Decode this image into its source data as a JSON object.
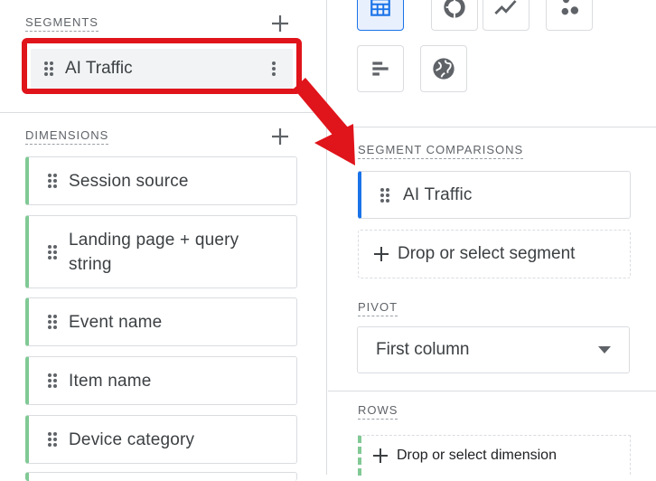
{
  "segments": {
    "title": "SEGMENTS",
    "items": [
      {
        "label": "AI Traffic"
      }
    ]
  },
  "dimensions": {
    "title": "DIMENSIONS",
    "items": [
      {
        "label": "Session source"
      },
      {
        "label": "Landing page + query string"
      },
      {
        "label": "Event name"
      },
      {
        "label": "Item name"
      },
      {
        "label": "Device category"
      }
    ]
  },
  "visualization": {
    "options": [
      {
        "icon": "table-icon",
        "selected": true
      },
      {
        "icon": "donut-chart-icon",
        "selected": false
      },
      {
        "icon": "line-chart-icon",
        "selected": false
      },
      {
        "icon": "scatter-chart-icon",
        "selected": false
      },
      {
        "icon": "bar-chart-icon",
        "selected": false
      },
      {
        "icon": "globe-icon",
        "selected": false
      }
    ]
  },
  "segment_comparisons": {
    "title": "SEGMENT COMPARISONS",
    "items": [
      {
        "label": "AI Traffic"
      }
    ],
    "drop_label": "Drop or select segment"
  },
  "pivot": {
    "title": "PIVOT",
    "value": "First column"
  },
  "rows": {
    "title": "ROWS",
    "drop_label": "Drop or select dimension"
  },
  "colors": {
    "accent_blue": "#1a73e8",
    "dimension_green": "#81c995",
    "annotation_red": "#e0141b"
  }
}
